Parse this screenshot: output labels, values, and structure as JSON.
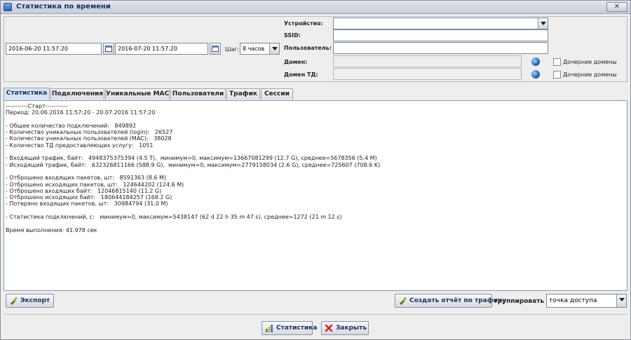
{
  "window": {
    "title": "Статистика по времени",
    "close_glyph": "✕"
  },
  "filters": {
    "date_from": "2016-06-20 11:57:20",
    "date_to": "2016-07-20 11:57:20",
    "step_label": "Шаг:",
    "step_value": "8 часов",
    "device_label": "Устройство:",
    "device_value": "",
    "ssid_label": "SSID:",
    "ssid_value": "",
    "user_label": "Пользователь:",
    "user_value": "",
    "domain_label": "Домен:",
    "domain_value": "",
    "ap_domain_label": "Домен ТД:",
    "ap_domain_value": "",
    "child_domains_label": "Дочерние домены",
    "child_domains_td_label": "Дочерние домены"
  },
  "tabs": [
    {
      "label": "Статистика",
      "active": true
    },
    {
      "label": "Подключения"
    },
    {
      "label": "Уникальные MAC"
    },
    {
      "label": "Пользователи"
    },
    {
      "label": "Трафик"
    },
    {
      "label": "Сессии"
    }
  ],
  "report_lines": [
    "-----------Старт-----------",
    "Период: 20.06.2016 11:57:20 - 20.07.2016 11:57:20",
    "",
    "- Общее количество подключений:   849892",
    "- Количество уникальных пользователей (login):   26527",
    "- Количество уникальных пользователей (MAC):   38028",
    "- Количество ТД предоставляющих услугу:   1051",
    "",
    "- Входящий трафик, байт:   4948375375394 (4.5 T),  минимум=0, максимум=13667081299 (12.7 G), среднее=5678356 (5.4 M)",
    "- Исходящий трафик, байт:   632326811166 (588.9 G),  минимум=0, максимум=2779158034 (2.6 G), среднее=725607 (708.6 K)",
    "",
    "- Отброшено входящих пакетов, шт:   8591363 (8.6 M)",
    "- Отброшено исходящих пакетов, шт:   124644202 (124.6 M)",
    "- Отброшено входящих байт:   12046815140 (11.2 G)",
    "- Отброшено исходящих байт:   180644184257 (168.2 G)",
    "- Потеряно входящих пакетов, шт:   30984794 (31.0 M)",
    "",
    "- Статистика подключений, с:   минимум=0, максимум=5438147 (62 d 22 h 35 m 47 s), среднее=1272 (21 m 12 s)",
    "",
    "Время выполнения: 41.978 сек"
  ],
  "actions": {
    "export_label": "Экспорт",
    "traffic_report_label": "Создать отчёт по трафику",
    "group_by_label": "группировать по:",
    "group_by_value": "точка доступа",
    "statistics_label": "Статистика",
    "close_label": "Закрыть"
  },
  "colors": {
    "accent": "#1c2f5a",
    "close_red": "#d02020"
  }
}
